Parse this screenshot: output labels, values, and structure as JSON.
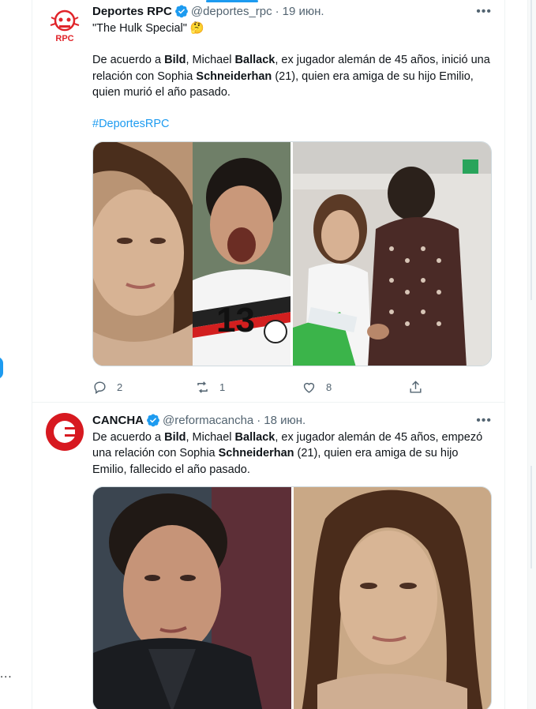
{
  "left": {
    "more": "..."
  },
  "tweets": [
    {
      "name": "Deportes RPC",
      "handle": "@deportes_rpc",
      "separator": "·",
      "date": "19 июн.",
      "avatar_text": "RPC",
      "line1": "\"The Hulk Special\" 🤔",
      "p1": "De acuerdo a ",
      "b1": "Bild",
      "p2": ", Michael ",
      "b2": "Ballack",
      "p3": ", ex jugador alemán de 45 años, inició una relación con Sophia ",
      "b3": "Schneiderhan",
      "p4": " (21), quien era amiga de su hijo Emilio, quien murió el año pasado.",
      "hashtag": "#DeportesRPC",
      "replies": "2",
      "retweets": "1",
      "likes": "8"
    },
    {
      "name": "CANCHA",
      "handle": "@reformacancha",
      "separator": "·",
      "date": "18 июн.",
      "p1": "De acuerdo a ",
      "b1": "Bild",
      "p2": ", Michael ",
      "b2": "Ballack",
      "p3": ", ex jugador alemán de 45 años, empezó una relación con Sophia ",
      "b3": "Schneiderhan",
      "p4": " (21), quien era amiga de su hijo Emilio, fallecido el año pasado."
    }
  ],
  "colors": {
    "accent": "#1d9bf0",
    "rpc_red": "#e0242a",
    "cancha_red": "#d71920"
  }
}
